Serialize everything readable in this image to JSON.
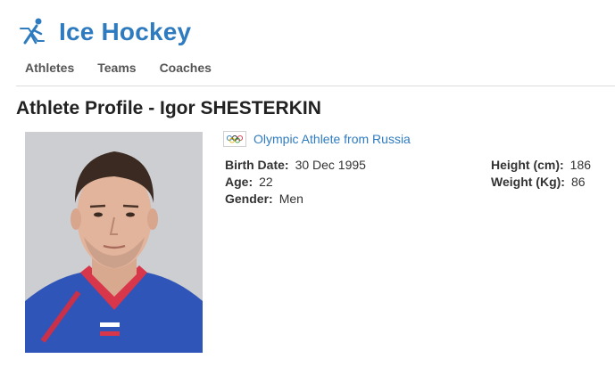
{
  "header": {
    "sport_title": "Ice Hockey",
    "icon": "hockey-player-icon",
    "brand_color": "#2f7bbf"
  },
  "nav": {
    "items": [
      "Athletes",
      "Teams",
      "Coaches"
    ]
  },
  "profile": {
    "title": "Athlete Profile - Igor SHESTERKIN",
    "country": "Olympic Athlete from Russia",
    "flag_icon": "olympic-rings-icon",
    "fields_left": [
      {
        "label": "Birth Date:",
        "value": "30 Dec 1995"
      },
      {
        "label": "Age:",
        "value": "22"
      },
      {
        "label": "Gender:",
        "value": "Men"
      }
    ],
    "fields_right": [
      {
        "label": "Height (cm):",
        "value": "186"
      },
      {
        "label": "Weight (Kg):",
        "value": "86"
      }
    ]
  }
}
